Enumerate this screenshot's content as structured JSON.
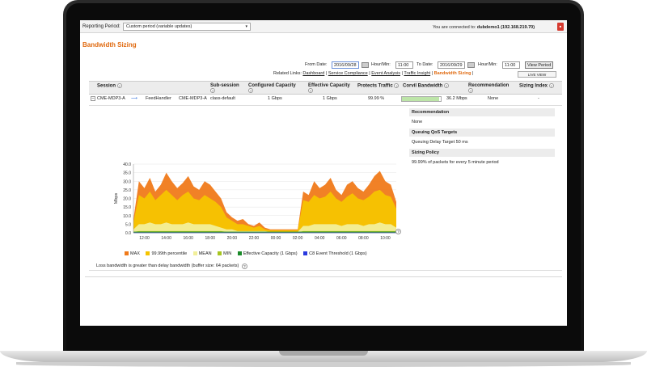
{
  "topbar": {
    "reporting_period_label": "Reporting Period:",
    "reporting_period_value": "Custom period (variable updates)",
    "connected_prefix": "You are connected to:",
    "connected_host": "dubdemo1 (192.168.219.70)",
    "pdf_icon": "pdf-icon"
  },
  "page_title": "Bandwidth Sizing",
  "date_controls": {
    "from_label": "From Date:",
    "from_date": "2016/09/28",
    "hour_label_1": "Hour/Min:",
    "from_time": "11:00",
    "to_label": "To Date:",
    "to_date": "2016/09/29",
    "hour_label_2": "Hour/Min:",
    "to_time": "11:00",
    "view_button": "View Period"
  },
  "related_links": {
    "label": "Related Links:",
    "items": [
      "Dashboard",
      "Service Compliance",
      "Event Analysis",
      "Traffic Insight",
      "Bandwidth Sizing"
    ],
    "live_view": "LIVE VIEW"
  },
  "table": {
    "headers": [
      "Session",
      "Sub-session",
      "Configured Capacity",
      "Effective Capacity",
      "Protects Traffic",
      "Corvil Bandwidth",
      "Recommendation",
      "Sizing Index"
    ],
    "row": {
      "expand": "–",
      "session_from": "CME-MDP3-A",
      "session_to": "FeedHandler",
      "session_dest": "CME-MDP3-A",
      "subsession": "class-default",
      "configured": "1 Gbps",
      "effective": "1 Gbps",
      "protects": "99.99 %",
      "corvil_bw": "36.2 Mbps",
      "recommendation": "None",
      "sizing_index": "-"
    }
  },
  "recommendation_panel": [
    {
      "heading": "Recommendation",
      "value": "None"
    },
    {
      "heading": "Queuing QoS Targets",
      "value": "Queuing Delay Target 50 ms"
    },
    {
      "heading": "Sizing Policy",
      "value": "99.99% of packets for every 5 minute period"
    }
  ],
  "chart_data": {
    "type": "area",
    "ylabel": "Mbps",
    "ylim": [
      0,
      40
    ],
    "yticks": [
      0,
      5,
      10,
      15,
      20,
      25,
      30,
      35,
      40
    ],
    "xticks": [
      "12:00",
      "14:00",
      "16:00",
      "18:00",
      "20:00",
      "22:00",
      "00:00",
      "02:00",
      "04:00",
      "06:00",
      "08:00",
      "10:00"
    ],
    "x_hours": [
      11,
      11.5,
      12,
      12.5,
      13,
      13.5,
      14,
      14.5,
      15,
      15.5,
      16,
      16.5,
      17,
      17.5,
      18,
      18.5,
      19,
      19.5,
      20,
      20.5,
      21,
      21.5,
      22,
      22.5,
      23,
      23.5,
      24,
      24.5,
      25,
      25.5,
      26,
      26.5,
      27,
      27.5,
      28,
      28.5,
      29,
      29.5,
      30,
      30.5,
      31,
      31.5,
      32,
      32.5,
      33,
      33.5,
      34,
      34.5,
      35
    ],
    "series": [
      {
        "name": "MAX",
        "color": "#f07a1a",
        "values": [
          8,
          30,
          26,
          32,
          24,
          28,
          35,
          30,
          26,
          29,
          33,
          27,
          25,
          30,
          28,
          24,
          20,
          12,
          9,
          7,
          8,
          5,
          4,
          6,
          3,
          2,
          2,
          2,
          2,
          2,
          2,
          24,
          22,
          30,
          26,
          28,
          32,
          25,
          22,
          28,
          30,
          26,
          24,
          28,
          33,
          36,
          30,
          28,
          18
        ]
      },
      {
        "name": "99.99th percentile",
        "color": "#f5c400",
        "values": [
          6,
          22,
          20,
          24,
          19,
          22,
          25,
          22,
          19,
          22,
          24,
          20,
          19,
          22,
          20,
          18,
          15,
          9,
          7,
          5,
          5,
          4,
          3,
          4,
          2,
          1.5,
          1.5,
          1.5,
          1.5,
          1.5,
          1.5,
          19,
          18,
          22,
          20,
          21,
          24,
          20,
          18,
          21,
          23,
          20,
          19,
          21,
          24,
          25,
          22,
          21,
          14
        ]
      },
      {
        "name": "MEAN",
        "color": "#f2ef9a",
        "values": [
          2,
          5,
          5,
          6,
          5,
          5,
          6,
          5,
          5,
          5,
          6,
          5,
          5,
          5,
          5,
          4,
          3,
          2,
          2,
          1,
          1,
          1,
          1,
          1,
          1,
          0.5,
          0.5,
          0.5,
          0.5,
          0.5,
          0.5,
          4,
          4,
          5,
          5,
          5,
          5,
          5,
          4,
          5,
          5,
          5,
          4,
          5,
          5,
          6,
          5,
          5,
          3
        ]
      },
      {
        "name": "MIN",
        "color": "#a7c520",
        "values": [
          0.5,
          1,
          1,
          1,
          1,
          1,
          1,
          1,
          1,
          1,
          1,
          1,
          1,
          1,
          1,
          1,
          1,
          0.5,
          0.5,
          0.5,
          0.5,
          0.5,
          0.5,
          0.5,
          0.5,
          0.2,
          0.2,
          0.2,
          0.2,
          0.2,
          0.2,
          1,
          1,
          1,
          1,
          1,
          1,
          1,
          1,
          1,
          1,
          1,
          1,
          1,
          1,
          1,
          1,
          1,
          1
        ]
      },
      {
        "name": "Effective Capacity (1 Gbps)",
        "color": "#1a8a2a",
        "values": []
      },
      {
        "name": "C8 Event Threshold (1 Gbps)",
        "color": "#2a3adf",
        "values": []
      }
    ]
  },
  "footnote": "Loss bandwidth is greater than delay bandwidth (buffer size: 64 packets)"
}
